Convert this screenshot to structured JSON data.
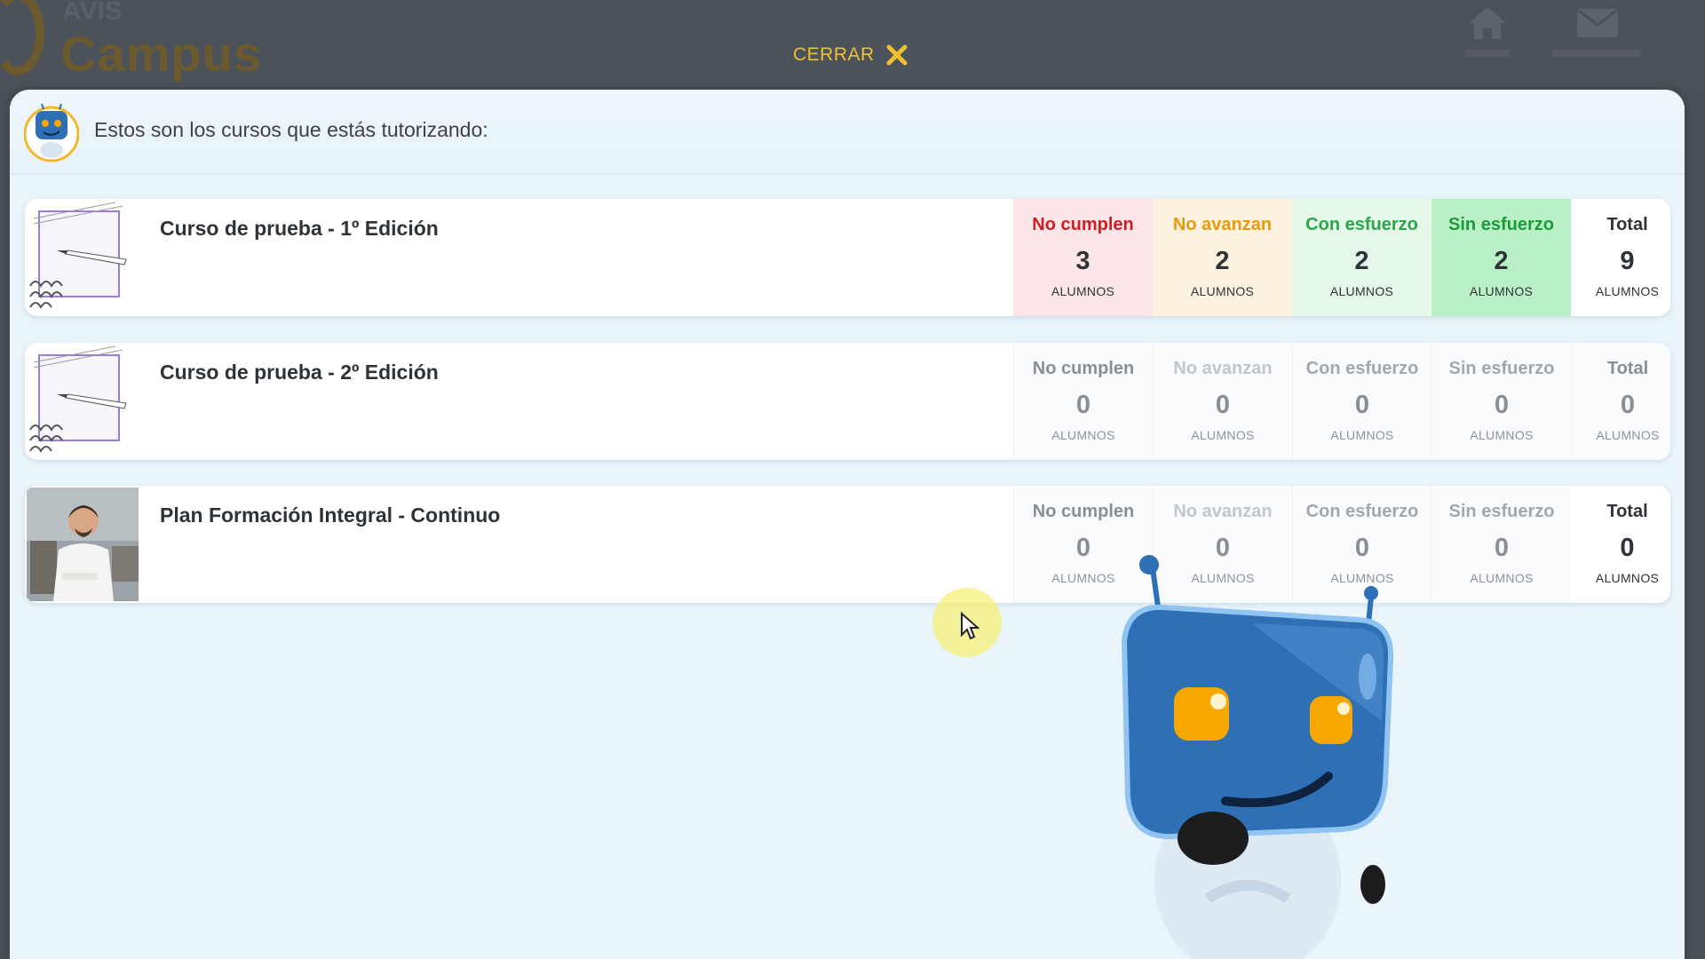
{
  "background": {
    "brand_small": "AVIS",
    "brand": "Campus"
  },
  "close": {
    "label": "CERRAR",
    "icon": "close-icon"
  },
  "modal": {
    "header_text": "Estos son los cursos que estás tutorizando:",
    "courses": [
      {
        "title": "Curso de prueba - 1º Edición",
        "thumb": "notebook-pencil-thumbnail",
        "stats": [
          {
            "label": "No cumplen",
            "value": "3",
            "unit": "ALUMNOS"
          },
          {
            "label": "No avanzan",
            "value": "2",
            "unit": "ALUMNOS"
          },
          {
            "label": "Con esfuerzo",
            "value": "2",
            "unit": "ALUMNOS"
          },
          {
            "label": "Sin esfuerzo",
            "value": "2",
            "unit": "ALUMNOS"
          },
          {
            "label": "Total",
            "value": "9",
            "unit": "ALUMNOS"
          }
        ]
      },
      {
        "title": "Curso de prueba - 2º Edición",
        "thumb": "notebook-pencil-thumbnail",
        "stats": [
          {
            "label": "No cumplen",
            "value": "0",
            "unit": "ALUMNOS"
          },
          {
            "label": "No avanzan",
            "value": "0",
            "unit": "ALUMNOS"
          },
          {
            "label": "Con esfuerzo",
            "value": "0",
            "unit": "ALUMNOS"
          },
          {
            "label": "Sin esfuerzo",
            "value": "0",
            "unit": "ALUMNOS"
          },
          {
            "label": "Total",
            "value": "0",
            "unit": "ALUMNOS"
          }
        ]
      },
      {
        "title": "Plan Formación Integral - Continuo",
        "thumb": "chef-photo-thumbnail",
        "stats": [
          {
            "label": "No cumplen",
            "value": "0",
            "unit": "ALUMNOS"
          },
          {
            "label": "No avanzan",
            "value": "0",
            "unit": "ALUMNOS"
          },
          {
            "label": "Con esfuerzo",
            "value": "0",
            "unit": "ALUMNOS"
          },
          {
            "label": "Sin esfuerzo",
            "value": "0",
            "unit": "ALUMNOS"
          },
          {
            "label": "Total",
            "value": "0",
            "unit": "ALUMNOS"
          }
        ]
      }
    ]
  },
  "colors": {
    "accent_close": "#f0c030",
    "no_cumplen": "#cc1f25",
    "no_avanzan": "#e69a10",
    "con_esfuerzo": "#2ea44b",
    "sin_esfuerzo_bg": "#b9f0c5",
    "robot_blue": "#2f6fb5"
  }
}
